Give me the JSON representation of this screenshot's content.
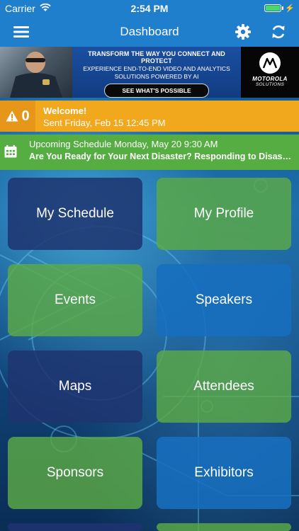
{
  "status_bar": {
    "carrier": "Carrier",
    "time": "2:54 PM",
    "battery_level": 1.0
  },
  "navbar": {
    "title": "Dashboard",
    "menu_icon": "hamburger-menu-icon",
    "settings_icon": "gear-icon",
    "refresh_icon": "refresh-icon"
  },
  "banner": {
    "headline": "TRANSFORM THE WAY YOU CONNECT AND PROTECT",
    "subline_1": "EXPERIENCE END-TO-END VIDEO AND ANALYTICS",
    "subline_2": "SOLUTIONS POWERED BY AI",
    "cta": "SEE WHAT'S POSSIBLE",
    "logo_line_1": "MOTOROLA",
    "logo_line_2": "SOLUTIONS"
  },
  "alert": {
    "count": "0",
    "title": "Welcome!",
    "sent": "Sent Friday, Feb 15 12:45 PM",
    "color": "#f2a81d"
  },
  "schedule": {
    "heading": "Upcoming Schedule Monday, May 20 9:30 AM",
    "session": "Are You Ready for Your Next Disaster? Responding to Disaster Events",
    "color": "#56ad42"
  },
  "tiles": [
    {
      "label": "My Schedule"
    },
    {
      "label": "My Profile"
    },
    {
      "label": "Events"
    },
    {
      "label": "Speakers"
    },
    {
      "label": "Maps"
    },
    {
      "label": "Attendees"
    },
    {
      "label": "Sponsors"
    },
    {
      "label": "Exhibitors"
    }
  ]
}
